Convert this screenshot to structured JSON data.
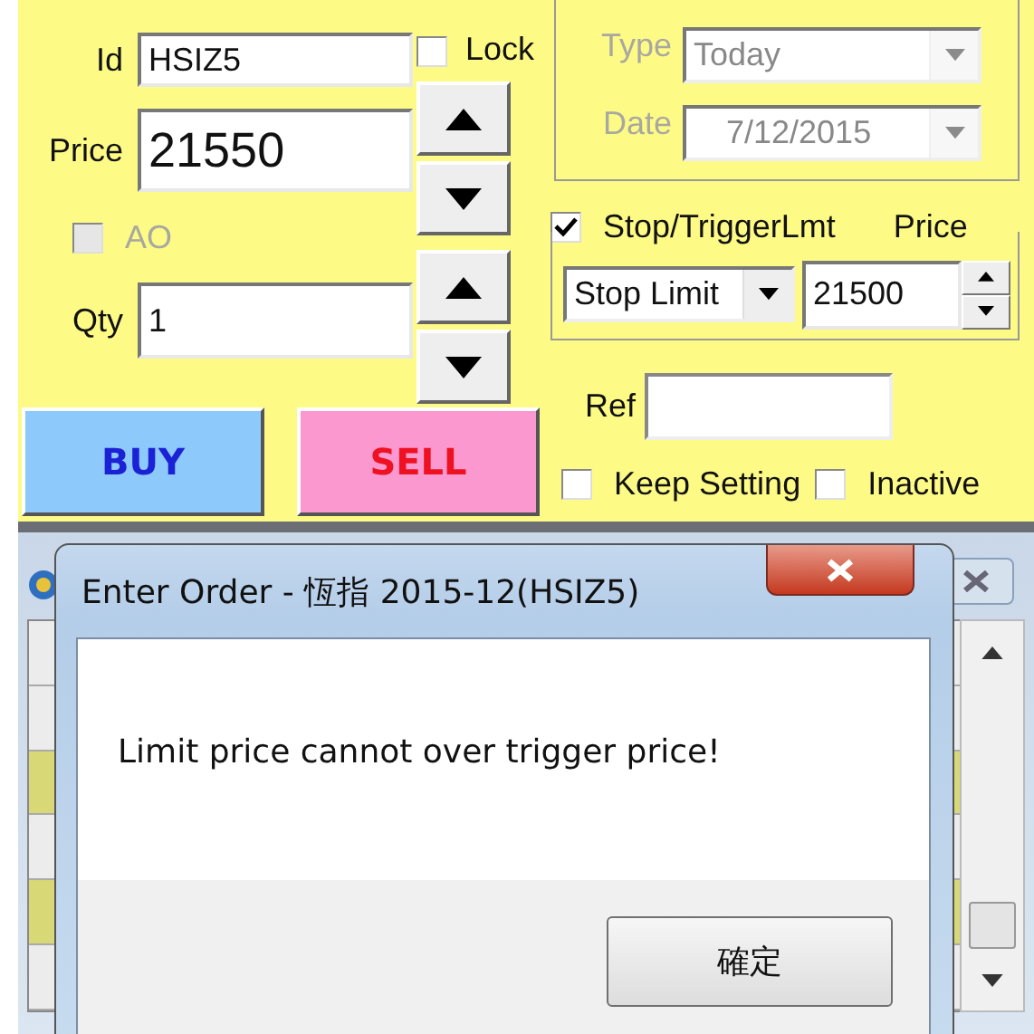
{
  "order_form": {
    "id": {
      "label": "Id",
      "value": "HSIZ5"
    },
    "lock": {
      "label": "Lock",
      "checked": false
    },
    "price": {
      "label": "Price",
      "value": "21550"
    },
    "ao": {
      "label": "AO",
      "checked": false,
      "disabled": true
    },
    "qty": {
      "label": "Qty",
      "value": "1"
    },
    "buy_button": "BUY",
    "sell_button": "SELL",
    "validity": {
      "type": {
        "label": "Type",
        "value": "Today",
        "disabled": true
      },
      "date": {
        "label": "Date",
        "value": "7/12/2015",
        "disabled": true
      }
    },
    "stop": {
      "label": "Stop/TriggerLmt",
      "checked": true,
      "price_label": "Price",
      "order_type": "Stop Limit",
      "trigger_price": "21500"
    },
    "ref": {
      "label": "Ref"
    },
    "keep_setting": {
      "label": "Keep Setting",
      "checked": false
    },
    "inactive": {
      "label": "Inactive",
      "checked": false
    }
  },
  "dialog": {
    "title": "Enter Order - 恆指 2015-12(HSIZ5)",
    "message": "Limit price cannot over trigger price!",
    "buttons": [
      "確定"
    ]
  }
}
